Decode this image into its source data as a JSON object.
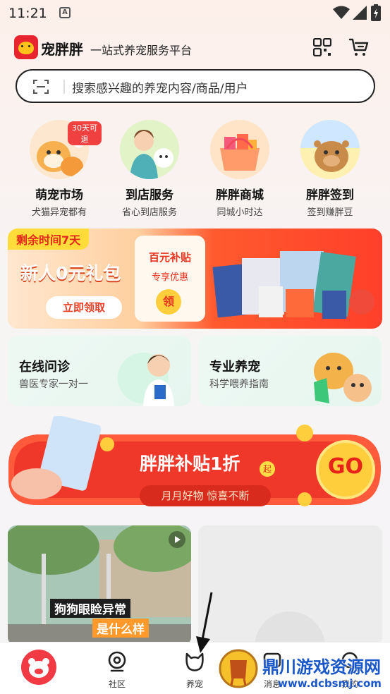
{
  "status": {
    "time": "11:21",
    "indicator": "A"
  },
  "header": {
    "brand": "宠胖胖",
    "slogan": "一站式养宠服务平台"
  },
  "search": {
    "placeholder": "搜索感兴趣的养宠内容/商品/用户"
  },
  "quick_entries": [
    {
      "title": "萌宠市场",
      "sub": "犬猫异宠都有",
      "badge": "30天可退"
    },
    {
      "title": "到店服务",
      "sub": "省心到店服务"
    },
    {
      "title": "胖胖商城",
      "sub": "同城小时达"
    },
    {
      "title": "胖胖签到",
      "sub": "签到赚胖豆"
    }
  ],
  "promo": {
    "tag": "剩余时间7天",
    "main": "新人0元礼包",
    "cta": "立即领取",
    "card_title": "百元补贴",
    "card_sub": "专享优惠",
    "coin": "领"
  },
  "services": [
    {
      "title": "在线问诊",
      "sub": "兽医专家一对一"
    },
    {
      "title": "专业养宠",
      "sub": "科学喂养指南"
    }
  ],
  "banner": {
    "main": "胖胖补贴1折",
    "qi": "起",
    "sub": "月月好物 惊喜不断",
    "go": "GO"
  },
  "feed": {
    "caption1": "狗狗眼睑异常",
    "caption2": "是什么样"
  },
  "tabs": [
    {
      "label": "社区"
    },
    {
      "label": "养宠"
    },
    {
      "label": "消息"
    },
    {
      "label": "我的"
    }
  ],
  "watermark": {
    "title": "鼎川游戏资源网",
    "url": "www.dcbsmj.com"
  },
  "colors": {
    "brand_red": "#e8242e",
    "accent_orange": "#ff5a2e",
    "tab_home": "#f23a45"
  }
}
